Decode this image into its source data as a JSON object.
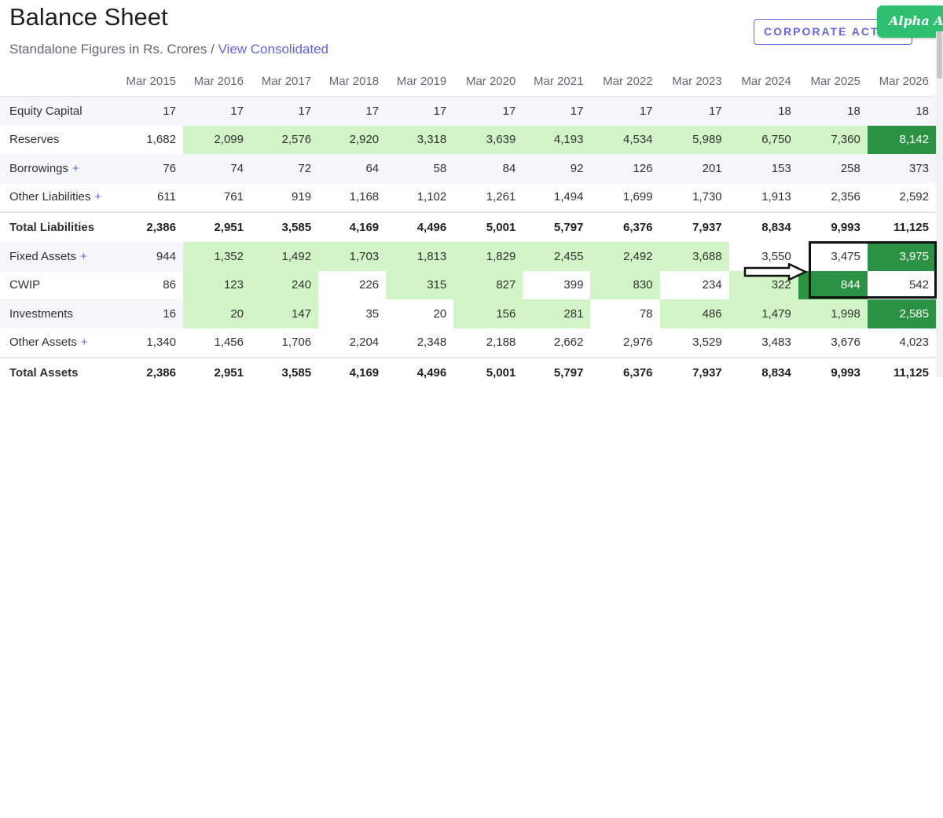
{
  "header": {
    "title": "Balance Sheet",
    "subtitle_text": "Standalone Figures in Rs. Crores / ",
    "view_link": "View Consolidated",
    "corporate_actions_label": "CORPORATE ACTI",
    "alpha_badge": "Alpha Ass"
  },
  "colors": {
    "accent": "#6366d8",
    "light_green": "#d2f5c7",
    "dark_green": "#2c9243",
    "badge_green": "#2fbf71"
  },
  "table": {
    "years": [
      "Mar 2015",
      "Mar 2016",
      "Mar 2017",
      "Mar 2018",
      "Mar 2019",
      "Mar 2020",
      "Mar 2021",
      "Mar 2022",
      "Mar 2023",
      "Mar 2024",
      "Mar 2025",
      "Mar 2026"
    ],
    "rows": [
      {
        "label": "Equity Capital",
        "expandable": false,
        "total": false,
        "values": [
          "17",
          "17",
          "17",
          "17",
          "17",
          "17",
          "17",
          "17",
          "17",
          "18",
          "18",
          "18"
        ],
        "shades": [
          "",
          "",
          "",
          "",
          "",
          "",
          "",
          "",
          "",
          "",
          "",
          ""
        ]
      },
      {
        "label": "Reserves",
        "expandable": false,
        "total": false,
        "values": [
          "1,682",
          "2,099",
          "2,576",
          "2,920",
          "3,318",
          "3,639",
          "4,193",
          "4,534",
          "5,989",
          "6,750",
          "7,360",
          "8,142"
        ],
        "shades": [
          "",
          "lg",
          "lg",
          "lg",
          "lg",
          "lg",
          "lg",
          "lg",
          "lg",
          "lg",
          "lg",
          "dg"
        ]
      },
      {
        "label": "Borrowings",
        "expandable": true,
        "total": false,
        "values": [
          "76",
          "74",
          "72",
          "64",
          "58",
          "84",
          "92",
          "126",
          "201",
          "153",
          "258",
          "373"
        ],
        "shades": [
          "",
          "",
          "",
          "",
          "",
          "",
          "",
          "",
          "",
          "",
          "",
          ""
        ]
      },
      {
        "label": "Other Liabilities",
        "expandable": true,
        "total": false,
        "values": [
          "611",
          "761",
          "919",
          "1,168",
          "1,102",
          "1,261",
          "1,494",
          "1,699",
          "1,730",
          "1,913",
          "2,356",
          "2,592"
        ],
        "shades": [
          "",
          "",
          "",
          "",
          "",
          "",
          "",
          "",
          "",
          "",
          "",
          ""
        ]
      },
      {
        "label": "Total Liabilities",
        "expandable": false,
        "total": true,
        "values": [
          "2,386",
          "2,951",
          "3,585",
          "4,169",
          "4,496",
          "5,001",
          "5,797",
          "6,376",
          "7,937",
          "8,834",
          "9,993",
          "11,125"
        ],
        "shades": [
          "",
          "",
          "",
          "",
          "",
          "",
          "",
          "",
          "",
          "",
          "",
          ""
        ]
      },
      {
        "label": "Fixed Assets",
        "expandable": true,
        "total": false,
        "values": [
          "944",
          "1,352",
          "1,492",
          "1,703",
          "1,813",
          "1,829",
          "2,455",
          "2,492",
          "3,688",
          "3,550",
          "3,475",
          "3,975"
        ],
        "shades": [
          "",
          "lg",
          "lg",
          "lg",
          "lg",
          "lg",
          "lg",
          "lg",
          "lg",
          "wh",
          "wh",
          "dg"
        ]
      },
      {
        "label": "CWIP",
        "expandable": false,
        "total": false,
        "values": [
          "86",
          "123",
          "240",
          "226",
          "315",
          "827",
          "399",
          "830",
          "234",
          "322",
          "844",
          "542"
        ],
        "shades": [
          "",
          "lg",
          "lg",
          "wh",
          "lg",
          "lg",
          "wh",
          "lg",
          "wh",
          "lg",
          "dg",
          "wh"
        ]
      },
      {
        "label": "Investments",
        "expandable": false,
        "total": false,
        "values": [
          "16",
          "20",
          "147",
          "35",
          "20",
          "156",
          "281",
          "78",
          "486",
          "1,479",
          "1,998",
          "2,585"
        ],
        "shades": [
          "",
          "lg",
          "lg",
          "wh",
          "wh",
          "lg",
          "lg",
          "wh",
          "lg",
          "lg",
          "lg",
          "dg"
        ]
      },
      {
        "label": "Other Assets",
        "expandable": true,
        "total": false,
        "values": [
          "1,340",
          "1,456",
          "1,706",
          "2,204",
          "2,348",
          "2,188",
          "2,662",
          "2,976",
          "3,529",
          "3,483",
          "3,676",
          "4,023"
        ],
        "shades": [
          "",
          "",
          "",
          "",
          "",
          "",
          "",
          "",
          "",
          "",
          "",
          ""
        ]
      },
      {
        "label": "Total Assets",
        "expandable": false,
        "total": true,
        "values": [
          "2,386",
          "2,951",
          "3,585",
          "4,169",
          "4,496",
          "5,001",
          "5,797",
          "6,376",
          "7,937",
          "8,834",
          "9,993",
          "11,125"
        ],
        "shades": [
          "",
          "",
          "",
          "",
          "",
          "",
          "",
          "",
          "",
          "",
          "",
          ""
        ]
      }
    ]
  }
}
